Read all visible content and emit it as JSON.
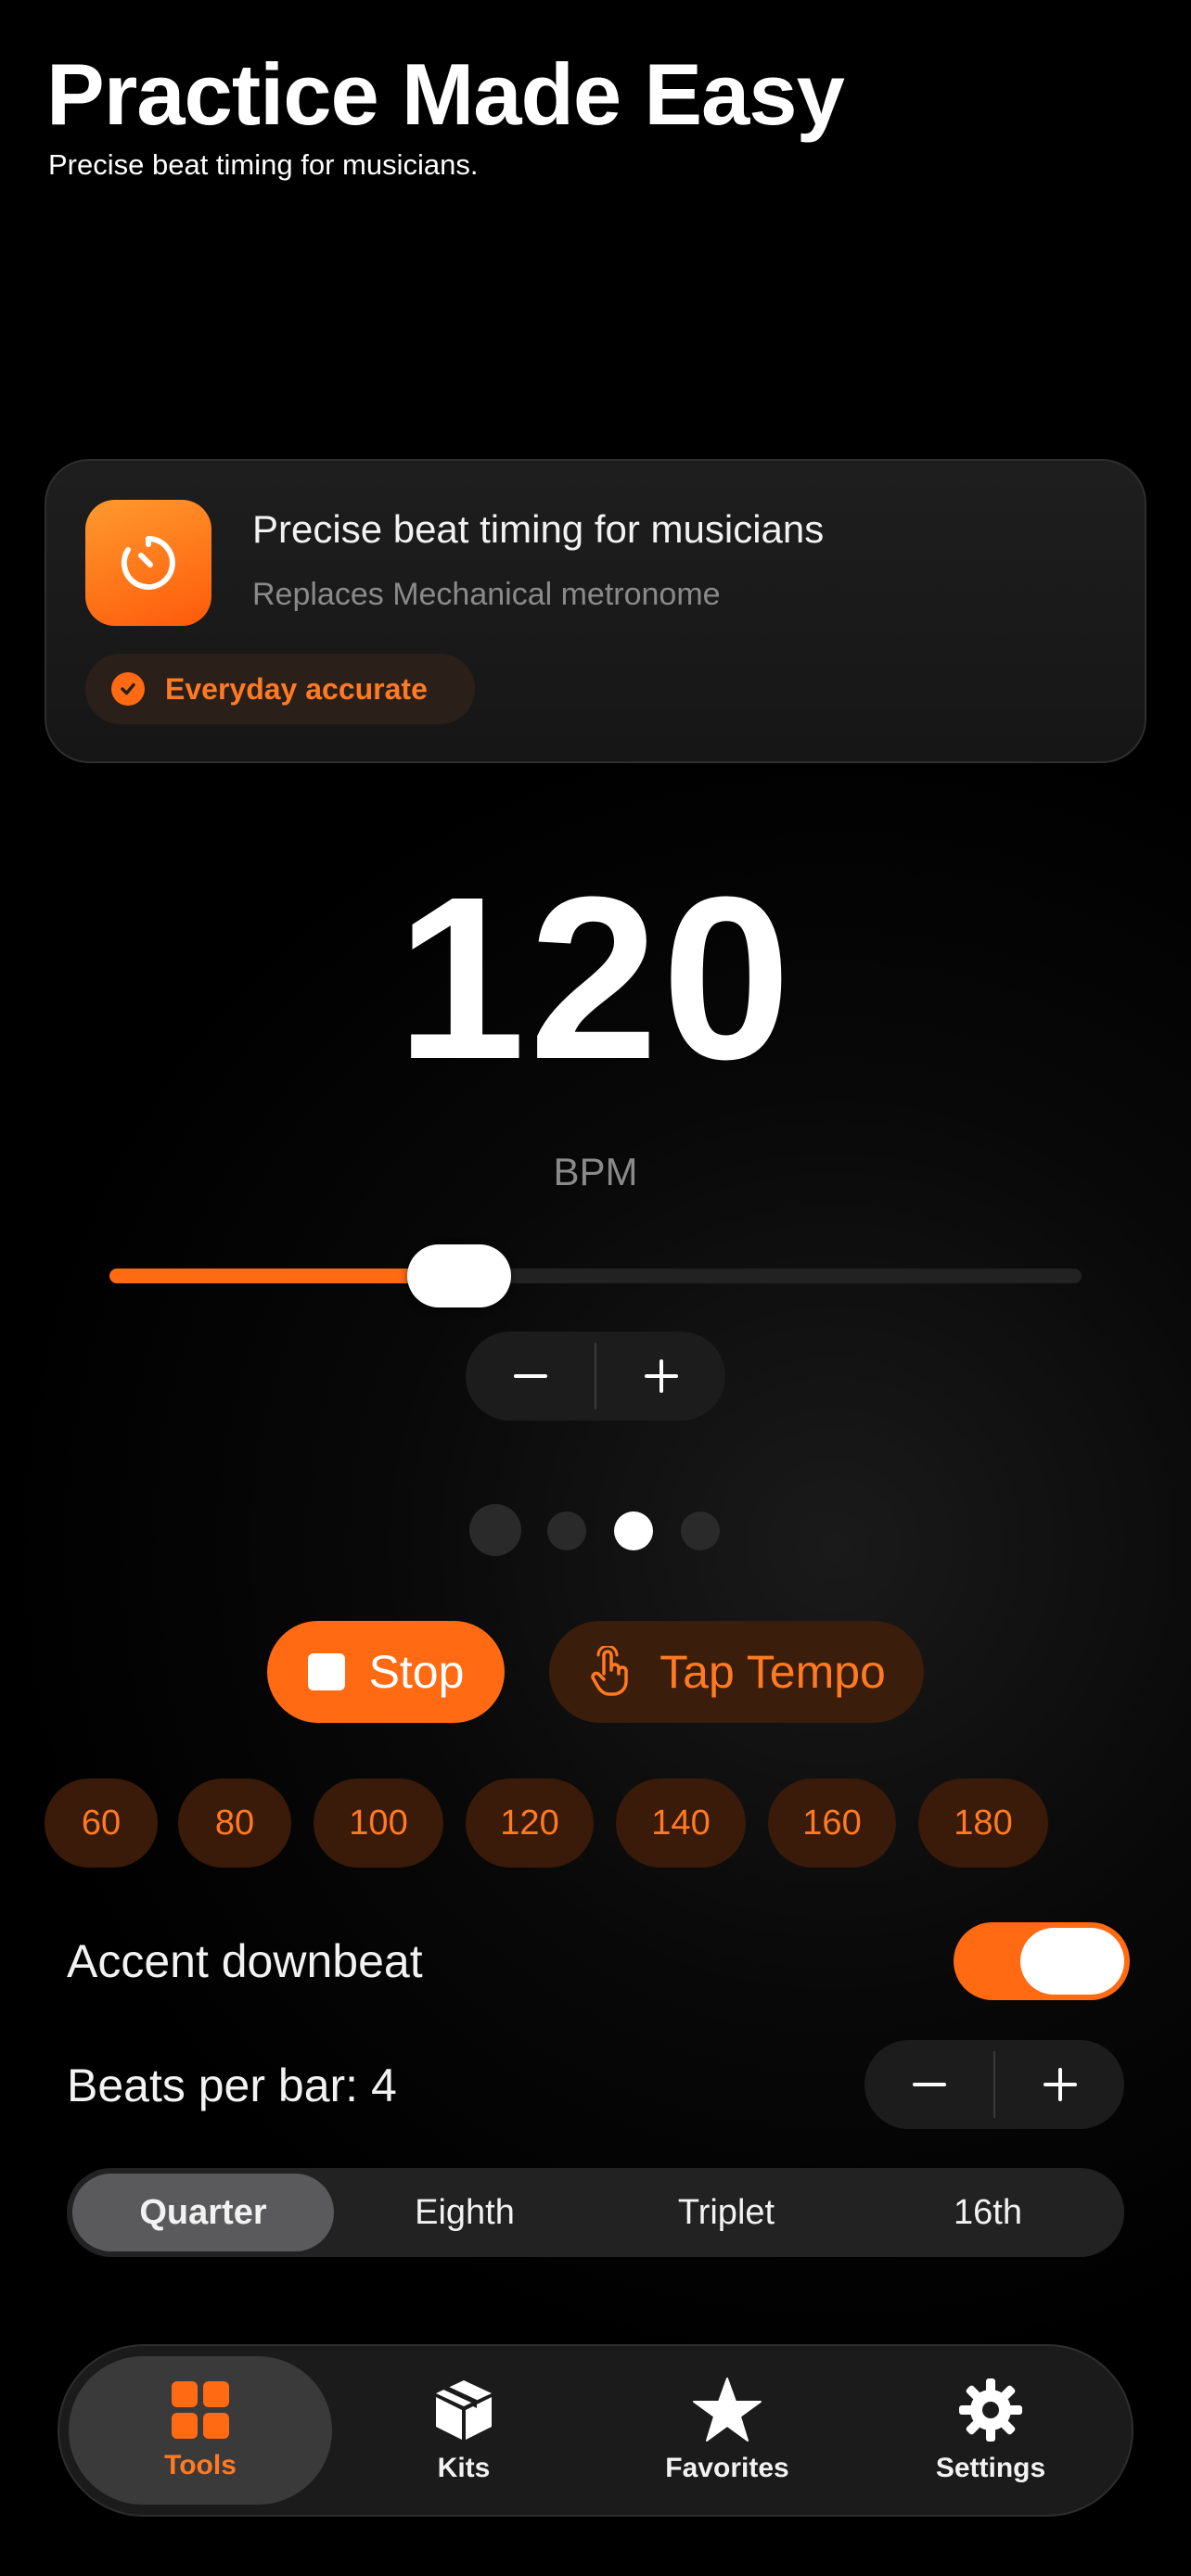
{
  "header": {
    "title": "Practice Made Easy",
    "subtitle": "Precise beat timing for musicians."
  },
  "info_card": {
    "icon": "timer-icon",
    "title": "Precise beat timing for musicians",
    "subtitle": "Replaces Mechanical metronome",
    "badge_label": "Everyday accurate",
    "badge_icon": "checkmark-circle-icon"
  },
  "tempo": {
    "bpm": "120",
    "unit": "BPM",
    "slider_fraction": 0.36
  },
  "beat_dots": {
    "count": 4,
    "active_index": 2
  },
  "actions": {
    "stop_label": "Stop",
    "tap_label": "Tap Tempo"
  },
  "presets": [
    "60",
    "80",
    "100",
    "120",
    "140",
    "160",
    "180"
  ],
  "settings": {
    "accent_label": "Accent downbeat",
    "accent_on": true,
    "beats_label": "Beats per bar: 4"
  },
  "subdivision": {
    "options": [
      "Quarter",
      "Eighth",
      "Triplet",
      "16th"
    ],
    "selected": "Quarter"
  },
  "tabbar": {
    "items": [
      {
        "label": "Tools",
        "icon": "grid-icon",
        "active": true
      },
      {
        "label": "Kits",
        "icon": "box-icon",
        "active": false
      },
      {
        "label": "Favorites",
        "icon": "star-icon",
        "active": false
      },
      {
        "label": "Settings",
        "icon": "gear-icon",
        "active": false
      }
    ]
  },
  "colors": {
    "accent": "#ff6a13",
    "accent_dark": "#3a1a08",
    "background": "#000000"
  }
}
